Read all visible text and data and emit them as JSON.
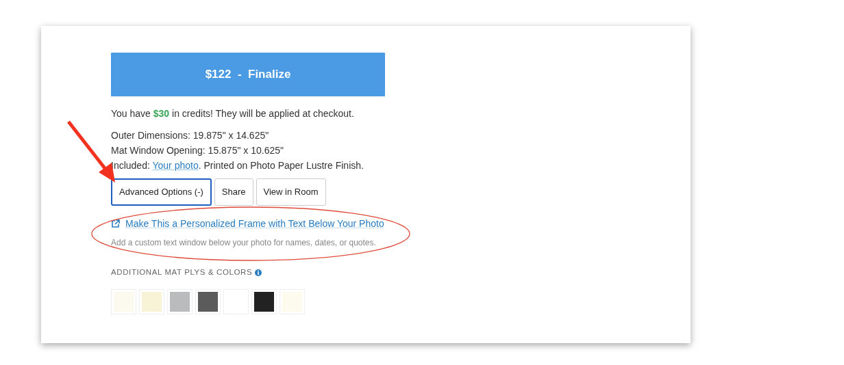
{
  "finalize_button": {
    "price": "$122",
    "separator": "-",
    "label": "Finalize"
  },
  "credits_note": "You have **$30** in credits! They will be applied at checkout.",
  "details": [
    "Outer Dimensions: 19.875\" x 14.625\"",
    "Mat Window Opening: 15.875\" x 10.625\""
  ],
  "included": {
    "label": "Included:",
    "link": "Your photo",
    "rest": ". Printed on Photo Paper Lustre Finish."
  },
  "option_buttons": [
    {
      "label": "Advanced Options (-)",
      "selected": true
    },
    {
      "label": "Share",
      "selected": false
    },
    {
      "label": "View in Room",
      "selected": false
    }
  ],
  "personalize": {
    "link": "Make This a Personalized Frame with Text Below Your Photo",
    "hint": "Add a custom text window below your photo for names, dates, or quotes."
  },
  "mat_section": {
    "title": "ADDITIONAL MAT PLYS & COLORS",
    "swatches": [
      {
        "color": "#fcfaee"
      },
      {
        "color": "#f8f3d6"
      },
      {
        "color": "#b9bbbd"
      },
      {
        "color": "#5b5b5b"
      },
      {
        "color": "#ffffff"
      },
      {
        "color": "#222222"
      },
      {
        "color": "#fdfaee"
      }
    ]
  },
  "annotations": {
    "arrow": true,
    "ellipse": true
  }
}
